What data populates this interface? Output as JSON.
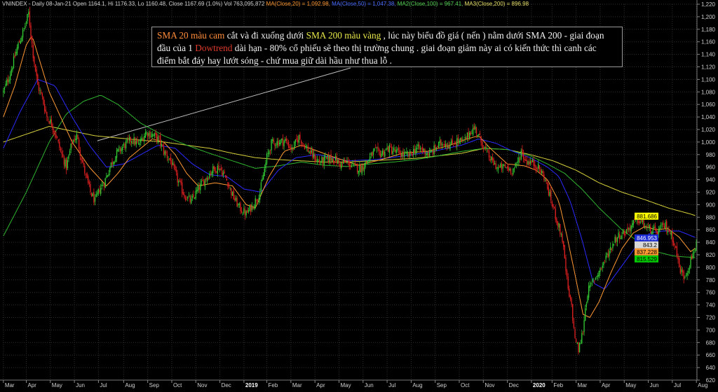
{
  "header": {
    "ticker_info": "VNINDEX - Daily 08-Jan-21 Open 1164.1, Hi 1176.33, Lo 1160.48, Close 1167.69 (1.0%) Vol 763,095,872",
    "ma20": "MA(Close,20) = 1,092.98,",
    "ma_blue": "MA(Close,50) = 1,047.38,",
    "ma100": "MA2(Close,100) = 967.41,",
    "ma200": "MA3(Close,200) = 896.98"
  },
  "annotation": {
    "part1": "SMA 20 màu cam",
    "part2": " cắt và đi xuống dưới ",
    "part3": "SMA 200 màu vàng",
    "part4": " , lúc này biểu đồ giá ( nến ) nằm dưới SMA 200 - giai đoạn đầu của 1 ",
    "part5": "Dowtrend",
    "part6": " dài hạn - 80% cổ phiếu sẽ theo thị trường chung . giai đoạn giảm này ai có kiến thức thì canh các điểm bắt đáy hay lướt sóng - chứ mua giữ dài hầu như thua lỗ ."
  },
  "colors": {
    "up": "#33cc33",
    "down": "#e02020",
    "sma20": "#ff9933",
    "sma50": "#2a2aff",
    "sma100": "#2fb52f",
    "sma200": "#d4cf3a",
    "grid": "#303030",
    "axis_text": "#cfcfcf"
  },
  "chart_data": {
    "type": "candlestick",
    "title": "VNINDEX - Daily",
    "ylim": [
      620,
      1220
    ],
    "y_ticks": [
      620,
      640,
      660,
      680,
      700,
      720,
      740,
      760,
      780,
      800,
      820,
      840,
      860,
      880,
      900,
      920,
      940,
      960,
      980,
      1000,
      1020,
      1040,
      1060,
      1080,
      1100,
      1120,
      1140,
      1160,
      1180,
      1200,
      1220
    ],
    "x_labels": [
      {
        "label": "Mar",
        "bar": 0
      },
      {
        "label": "Apr",
        "bar": 20
      },
      {
        "label": "May",
        "bar": 41
      },
      {
        "label": "Jun",
        "bar": 62
      },
      {
        "label": "Jul",
        "bar": 83
      },
      {
        "label": "Aug",
        "bar": 105
      },
      {
        "label": "Sep",
        "bar": 126
      },
      {
        "label": "Oct",
        "bar": 147
      },
      {
        "label": "Nov",
        "bar": 168
      },
      {
        "label": "Dec",
        "bar": 189
      },
      {
        "label": "2019",
        "bar": 210
      },
      {
        "label": "Feb",
        "bar": 230
      },
      {
        "label": "Mar",
        "bar": 251
      },
      {
        "label": "Apr",
        "bar": 272
      },
      {
        "label": "May",
        "bar": 293
      },
      {
        "label": "Jun",
        "bar": 314
      },
      {
        "label": "Jul",
        "bar": 335
      },
      {
        "label": "Aug",
        "bar": 356
      },
      {
        "label": "Sep",
        "bar": 377
      },
      {
        "label": "Oct",
        "bar": 398
      },
      {
        "label": "Nov",
        "bar": 419
      },
      {
        "label": "Dec",
        "bar": 440
      },
      {
        "label": "2020",
        "bar": 461
      },
      {
        "label": "Feb",
        "bar": 479
      },
      {
        "label": "Mar",
        "bar": 500
      },
      {
        "label": "Apr",
        "bar": 521
      },
      {
        "label": "May",
        "bar": 542
      },
      {
        "label": "Jun",
        "bar": 563
      },
      {
        "label": "Jul",
        "bar": 584
      },
      {
        "label": "Aug",
        "bar": 605
      }
    ],
    "close_anchors": [
      [
        0,
        1080
      ],
      [
        6,
        1110
      ],
      [
        12,
        1150
      ],
      [
        18,
        1180
      ],
      [
        22,
        1205
      ],
      [
        26,
        1140
      ],
      [
        30,
        1090
      ],
      [
        34,
        1070
      ],
      [
        38,
        1040
      ],
      [
        42,
        1030
      ],
      [
        46,
        1010
      ],
      [
        50,
        985
      ],
      [
        55,
        960
      ],
      [
        60,
        1000
      ],
      [
        64,
        1010
      ],
      [
        68,
        975
      ],
      [
        72,
        945
      ],
      [
        76,
        920
      ],
      [
        80,
        905
      ],
      [
        84,
        925
      ],
      [
        88,
        935
      ],
      [
        94,
        965
      ],
      [
        100,
        985
      ],
      [
        106,
        995
      ],
      [
        112,
        1005
      ],
      [
        118,
        995
      ],
      [
        124,
        1015
      ],
      [
        130,
        1012
      ],
      [
        136,
        1003
      ],
      [
        140,
        985
      ],
      [
        146,
        970
      ],
      [
        152,
        940
      ],
      [
        158,
        915
      ],
      [
        164,
        905
      ],
      [
        170,
        925
      ],
      [
        176,
        940
      ],
      [
        182,
        955
      ],
      [
        188,
        960
      ],
      [
        192,
        950
      ],
      [
        196,
        935
      ],
      [
        200,
        915
      ],
      [
        206,
        895
      ],
      [
        212,
        885
      ],
      [
        218,
        900
      ],
      [
        224,
        920
      ],
      [
        230,
        975
      ],
      [
        234,
        998
      ],
      [
        240,
        1000
      ],
      [
        246,
        1002
      ],
      [
        252,
        988
      ],
      [
        258,
        1008
      ],
      [
        264,
        992
      ],
      [
        270,
        978
      ],
      [
        276,
        968
      ],
      [
        282,
        972
      ],
      [
        288,
        975
      ],
      [
        294,
        965
      ],
      [
        300,
        968
      ],
      [
        306,
        960
      ],
      [
        312,
        958
      ],
      [
        318,
        970
      ],
      [
        324,
        985
      ],
      [
        330,
        982
      ],
      [
        336,
        990
      ],
      [
        342,
        985
      ],
      [
        348,
        980
      ],
      [
        354,
        978
      ],
      [
        360,
        990
      ],
      [
        366,
        988
      ],
      [
        372,
        980
      ],
      [
        378,
        992
      ],
      [
        384,
        1000
      ],
      [
        390,
        995
      ],
      [
        396,
        1002
      ],
      [
        402,
        1000
      ],
      [
        408,
        1018
      ],
      [
        412,
        1022
      ],
      [
        416,
        1005
      ],
      [
        420,
        990
      ],
      [
        426,
        970
      ],
      [
        432,
        958
      ],
      [
        438,
        960
      ],
      [
        444,
        955
      ],
      [
        448,
        962
      ],
      [
        452,
        985
      ],
      [
        456,
        970
      ],
      [
        460,
        968
      ],
      [
        466,
        962
      ],
      [
        472,
        945
      ],
      [
        476,
        920
      ],
      [
        480,
        895
      ],
      [
        484,
        870
      ],
      [
        488,
        845
      ],
      [
        490,
        810
      ],
      [
        492,
        780
      ],
      [
        494,
        750
      ],
      [
        496,
        740
      ],
      [
        498,
        700
      ],
      [
        500,
        680
      ],
      [
        502,
        668
      ],
      [
        504,
        682
      ],
      [
        506,
        700
      ],
      [
        508,
        735
      ],
      [
        510,
        760
      ],
      [
        514,
        775
      ],
      [
        518,
        788
      ],
      [
        522,
        800
      ],
      [
        526,
        815
      ],
      [
        530,
        830
      ],
      [
        534,
        845
      ],
      [
        538,
        852
      ],
      [
        542,
        855
      ],
      [
        546,
        862
      ],
      [
        550,
        870
      ],
      [
        554,
        876
      ],
      [
        558,
        870
      ],
      [
        562,
        862
      ],
      [
        566,
        860
      ],
      [
        570,
        855
      ],
      [
        574,
        862
      ],
      [
        578,
        866
      ],
      [
        582,
        856
      ],
      [
        586,
        838
      ],
      [
        590,
        800
      ],
      [
        594,
        785
      ],
      [
        598,
        800
      ],
      [
        602,
        822
      ],
      [
        605,
        840
      ]
    ],
    "ma_anchors": {
      "sma20": [
        [
          0,
          1040
        ],
        [
          10,
          1090
        ],
        [
          20,
          1155
        ],
        [
          25,
          1170
        ],
        [
          30,
          1140
        ],
        [
          40,
          1080
        ],
        [
          50,
          1040
        ],
        [
          60,
          1000
        ],
        [
          75,
          960
        ],
        [
          90,
          930
        ],
        [
          100,
          950
        ],
        [
          110,
          975
        ],
        [
          120,
          990
        ],
        [
          130,
          1005
        ],
        [
          140,
          1000
        ],
        [
          150,
          980
        ],
        [
          160,
          950
        ],
        [
          170,
          930
        ],
        [
          185,
          935
        ],
        [
          200,
          930
        ],
        [
          212,
          900
        ],
        [
          220,
          895
        ],
        [
          232,
          945
        ],
        [
          245,
          985
        ],
        [
          260,
          995
        ],
        [
          275,
          985
        ],
        [
          290,
          975
        ],
        [
          310,
          963
        ],
        [
          330,
          972
        ],
        [
          350,
          983
        ],
        [
          370,
          985
        ],
        [
          390,
          995
        ],
        [
          405,
          1005
        ],
        [
          415,
          1010
        ],
        [
          425,
          990
        ],
        [
          440,
          965
        ],
        [
          455,
          962
        ],
        [
          465,
          955
        ],
        [
          475,
          940
        ],
        [
          485,
          905
        ],
        [
          492,
          850
        ],
        [
          500,
          780
        ],
        [
          506,
          725
        ],
        [
          512,
          720
        ],
        [
          520,
          745
        ],
        [
          530,
          790
        ],
        [
          540,
          830
        ],
        [
          550,
          855
        ],
        [
          560,
          865
        ],
        [
          570,
          860
        ],
        [
          580,
          862
        ],
        [
          590,
          848
        ],
        [
          600,
          825
        ],
        [
          605,
          832
        ]
      ],
      "sma50": [
        [
          0,
          990
        ],
        [
          15,
          1050
        ],
        [
          30,
          1100
        ],
        [
          45,
          1090
        ],
        [
          60,
          1040
        ],
        [
          75,
          995
        ],
        [
          90,
          960
        ],
        [
          105,
          965
        ],
        [
          120,
          980
        ],
        [
          135,
          995
        ],
        [
          150,
          990
        ],
        [
          165,
          965
        ],
        [
          180,
          948
        ],
        [
          195,
          945
        ],
        [
          210,
          925
        ],
        [
          225,
          920
        ],
        [
          240,
          955
        ],
        [
          255,
          975
        ],
        [
          275,
          980
        ],
        [
          300,
          970
        ],
        [
          325,
          972
        ],
        [
          350,
          978
        ],
        [
          375,
          985
        ],
        [
          400,
          995
        ],
        [
          415,
          1005
        ],
        [
          430,
          998
        ],
        [
          445,
          985
        ],
        [
          460,
          975
        ],
        [
          475,
          960
        ],
        [
          485,
          945
        ],
        [
          495,
          905
        ],
        [
          505,
          845
        ],
        [
          515,
          775
        ],
        [
          525,
          765
        ],
        [
          535,
          790
        ],
        [
          545,
          815
        ],
        [
          555,
          840
        ],
        [
          565,
          855
        ],
        [
          575,
          858
        ],
        [
          590,
          858
        ],
        [
          605,
          847
        ]
      ],
      "sma100": [
        [
          0,
          850
        ],
        [
          20,
          920
        ],
        [
          40,
          1000
        ],
        [
          55,
          1045
        ],
        [
          70,
          1065
        ],
        [
          85,
          1075
        ],
        [
          100,
          1060
        ],
        [
          120,
          1030
        ],
        [
          140,
          1010
        ],
        [
          160,
          995
        ],
        [
          180,
          982
        ],
        [
          200,
          970
        ],
        [
          220,
          958
        ],
        [
          240,
          962
        ],
        [
          260,
          968
        ],
        [
          280,
          963
        ],
        [
          300,
          961
        ],
        [
          320,
          965
        ],
        [
          340,
          968
        ],
        [
          360,
          972
        ],
        [
          380,
          978
        ],
        [
          400,
          985
        ],
        [
          420,
          990
        ],
        [
          440,
          988
        ],
        [
          460,
          978
        ],
        [
          475,
          965
        ],
        [
          490,
          950
        ],
        [
          505,
          925
        ],
        [
          520,
          895
        ],
        [
          540,
          860
        ],
        [
          555,
          840
        ],
        [
          570,
          825
        ],
        [
          585,
          818
        ],
        [
          600,
          816
        ],
        [
          605,
          815
        ]
      ],
      "sma200": [
        [
          0,
          1000
        ],
        [
          40,
          1025
        ],
        [
          80,
          1010
        ],
        [
          120,
          1003
        ],
        [
          140,
          1000
        ],
        [
          160,
          995
        ],
        [
          180,
          990
        ],
        [
          200,
          982
        ],
        [
          220,
          975
        ],
        [
          240,
          972
        ],
        [
          260,
          970
        ],
        [
          280,
          968
        ],
        [
          300,
          968
        ],
        [
          320,
          970
        ],
        [
          340,
          972
        ],
        [
          360,
          974
        ],
        [
          380,
          978
        ],
        [
          400,
          982
        ],
        [
          420,
          990
        ],
        [
          440,
          988
        ],
        [
          460,
          980
        ],
        [
          480,
          970
        ],
        [
          500,
          955
        ],
        [
          520,
          935
        ],
        [
          540,
          920
        ],
        [
          560,
          908
        ],
        [
          580,
          895
        ],
        [
          600,
          885
        ],
        [
          605,
          882
        ]
      ]
    },
    "price_labels": [
      {
        "value": 881.686,
        "text": "881.686",
        "bg": "#ffff00",
        "fg": "#000000"
      },
      {
        "value": 846.953,
        "text": "846.953",
        "bg": "#1a2bd6",
        "fg": "#ffffff"
      },
      {
        "value": 843.2,
        "text": "843.2",
        "bg": "#d8d8d8",
        "fg": "#000000"
      },
      {
        "value": 837.228,
        "text": "837.228",
        "bg": "#ff9933",
        "fg": "#000000"
      },
      {
        "value": 815.529,
        "text": "815.529",
        "bg": "#00cc00",
        "fg": "#000000"
      }
    ]
  }
}
